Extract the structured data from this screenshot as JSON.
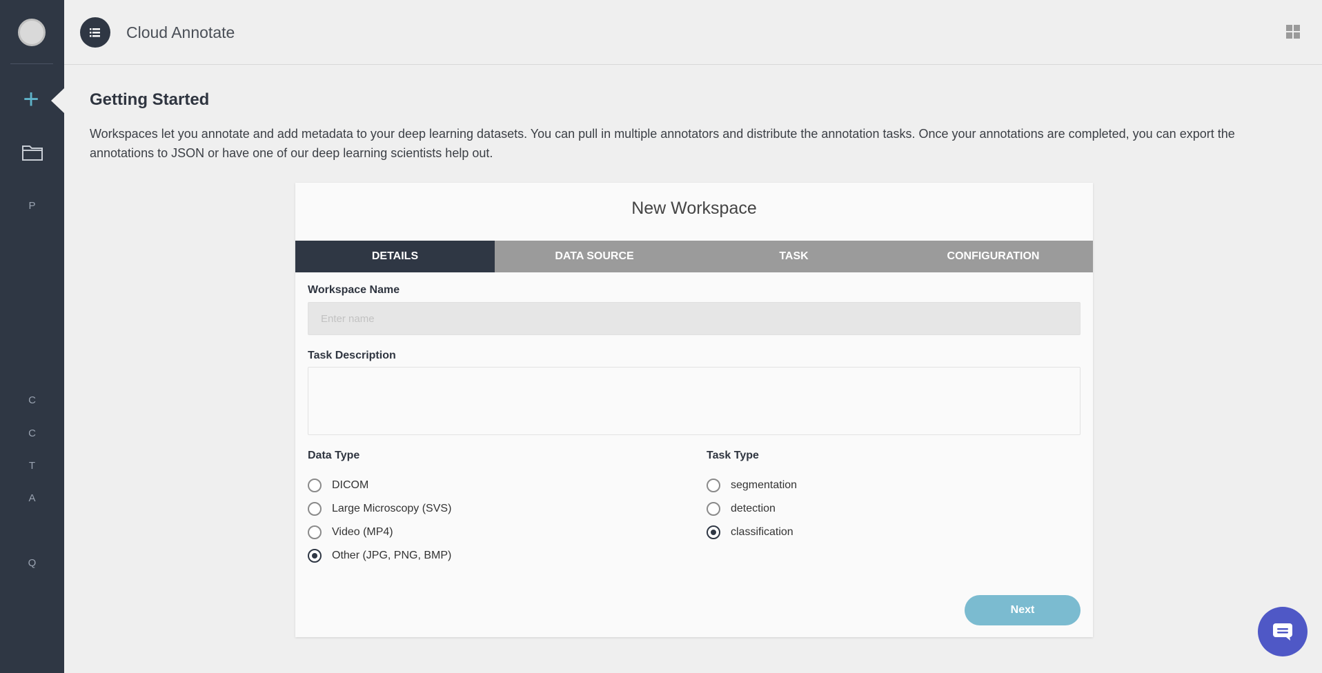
{
  "app": {
    "title": "Cloud Annotate"
  },
  "sidebar": {
    "letters": [
      "P",
      "C",
      "C",
      "T",
      "A",
      "Q"
    ]
  },
  "page": {
    "title": "Getting Started",
    "intro": "Workspaces let you annotate and add metadata to your deep learning datasets. You can pull in multiple annotators and distribute the annotation tasks. Once your annotations are completed, you can export the annotations to JSON or have one of our deep learning scientists help out."
  },
  "card": {
    "title": "New Workspace",
    "tabs": [
      "DETAILS",
      "DATA SOURCE",
      "TASK",
      "CONFIGURATION"
    ],
    "workspace_name_label": "Workspace Name",
    "workspace_name_placeholder": "Enter name",
    "workspace_name_value": "",
    "task_description_label": "Task Description",
    "task_description_value": "",
    "data_type_label": "Data Type",
    "data_type_options": [
      "DICOM",
      "Large Microscopy (SVS)",
      "Video (MP4)",
      "Other (JPG, PNG, BMP)"
    ],
    "data_type_selected": "Other (JPG, PNG, BMP)",
    "task_type_label": "Task Type",
    "task_type_options": [
      "segmentation",
      "detection",
      "classification"
    ],
    "task_type_selected": "classification",
    "next_label": "Next"
  },
  "colors": {
    "sidebar": "#2f3744",
    "accent": "#5fb3c9",
    "next_button": "#7bbbd0",
    "chat_button": "#4f58c6"
  }
}
